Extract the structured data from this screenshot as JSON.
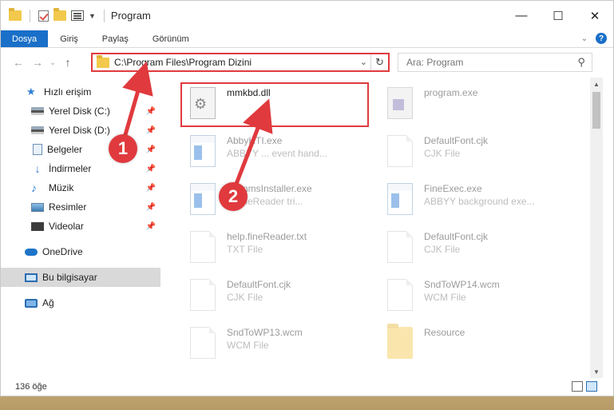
{
  "window": {
    "title": "Program",
    "controls": {
      "minimize": "—",
      "maximize": "☐",
      "close": "✕"
    }
  },
  "ribbon": {
    "tabs": [
      "Dosya",
      "Giriş",
      "Paylaş",
      "Görünüm"
    ],
    "help": "?"
  },
  "navigation": {
    "address_path": "C:\\Program Files\\Program Dizini",
    "search_placeholder": "Ara: Program"
  },
  "sidebar": {
    "items": [
      {
        "label": "Hızlı erişim",
        "icon": "star-icon"
      },
      {
        "label": "Yerel Disk (C:)",
        "icon": "disk-icon",
        "pinned": true
      },
      {
        "label": "Yerel Disk (D:)",
        "icon": "disk-icon",
        "pinned": true
      },
      {
        "label": "Belgeler",
        "icon": "documents-icon",
        "pinned": true
      },
      {
        "label": "İndirmeler",
        "icon": "downloads-icon",
        "pinned": true
      },
      {
        "label": "Müzik",
        "icon": "music-icon",
        "pinned": true
      },
      {
        "label": "Resimler",
        "icon": "pictures-icon",
        "pinned": true
      },
      {
        "label": "Videolar",
        "icon": "videos-icon",
        "pinned": true
      },
      {
        "label": "OneDrive",
        "icon": "onedrive-icon"
      },
      {
        "label": "Bu bilgisayar",
        "icon": "computer-icon",
        "selected": true
      },
      {
        "label": "Ağ",
        "icon": "network-icon"
      }
    ]
  },
  "files": [
    {
      "name": "mmkbd.dll",
      "type": "",
      "icon": "dll-icon"
    },
    {
      "name": "program.exe",
      "type": "",
      "icon": "exe-icon"
    },
    {
      "name": "AbbyHTI.exe",
      "type": "ABBYY ... event hand...",
      "icon": "app-icon"
    },
    {
      "name": "DefaultFont.cjk",
      "type": "CJK File",
      "icon": "document-icon"
    },
    {
      "name": "...ammsInstaller.exe",
      "type": "... fineReader tri...",
      "icon": "app-icon"
    },
    {
      "name": "FineExec.exe",
      "type": "ABBYY background exe...",
      "icon": "app-icon"
    },
    {
      "name": "help.fineReader.txt",
      "type": "TXT File",
      "icon": "document-icon"
    },
    {
      "name": "DefaultFont.cjk",
      "type": "CJK File",
      "icon": "document-icon"
    },
    {
      "name": "DefaultFont.cjk",
      "type": "CJK File",
      "icon": "document-icon"
    },
    {
      "name": "SndToWP14.wcm",
      "type": "WCM File",
      "icon": "document-icon"
    },
    {
      "name": "SndToWP13.wcm",
      "type": "WCM File",
      "icon": "document-icon"
    },
    {
      "name": "Resource",
      "type": "",
      "icon": "folder-icon"
    }
  ],
  "status": {
    "item_count": "136 öğe"
  },
  "annotations": {
    "step1": "1",
    "step2": "2"
  },
  "colors": {
    "accent": "#1a6fc8",
    "annotation": "#e03a3e"
  }
}
